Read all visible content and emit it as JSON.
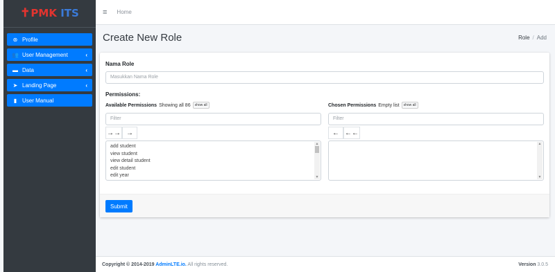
{
  "brand": {
    "cross": "✝",
    "name_red": "PMK",
    "name_blue": " ITS"
  },
  "sidebar": {
    "items": [
      {
        "label": "Profile",
        "icon": "user-circle-icon",
        "glyph": "⊛",
        "has_chevron": false
      },
      {
        "label": "User Management",
        "icon": "users-icon",
        "glyph": "👥",
        "has_chevron": true,
        "chevron": "‹"
      },
      {
        "label": "Data",
        "icon": "id-card-icon",
        "glyph": "▬",
        "has_chevron": true,
        "chevron": "‹"
      },
      {
        "label": "Landing Page",
        "icon": "pointer-icon",
        "glyph": "➤",
        "has_chevron": true,
        "chevron": "‹"
      },
      {
        "label": "User Manual",
        "icon": "book-reader-icon",
        "glyph": "▮",
        "has_chevron": false
      }
    ]
  },
  "topbar": {
    "menu_glyph": "≡",
    "home_label": "Home"
  },
  "header": {
    "title": "Create New Role",
    "breadcrumb": {
      "first": "Role",
      "separator": "/",
      "current": "Add"
    }
  },
  "form": {
    "role_label": "Nama Role",
    "role_placeholder": "Masukkan Nama Role",
    "permissions_label": "Permissions:",
    "available": {
      "title": "Available Permissions",
      "info": "Showing all 86",
      "showall": "show all",
      "filter_placeholder": "Filter",
      "btn_move_all": "→→",
      "btn_move": "→",
      "options": [
        "add student",
        "view student",
        "view detail student",
        "edit student",
        "edit year"
      ]
    },
    "chosen": {
      "title": "Chosen Permissions",
      "info": "Empty list",
      "showall": "show all",
      "filter_placeholder": "Filter",
      "btn_remove": "←",
      "btn_remove_all": "←←"
    },
    "submit_label": "Submit"
  },
  "footer": {
    "copyright_prefix": "Copyright © 2014-2019 ",
    "brand": "AdminLTE.io.",
    "rights": " All rights reserved.",
    "version_label": "Version",
    "version_value": " 3.0.5"
  },
  "colors": {
    "primary": "#007bff",
    "sidebar_bg": "#343a40",
    "brand_red": "#e3342f"
  }
}
